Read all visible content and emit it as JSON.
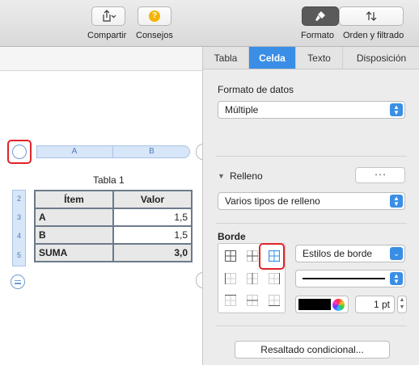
{
  "toolbar": {
    "share_label": "Compartir",
    "tips_label": "Consejos",
    "format_label": "Formato",
    "sort_label": "Orden y filtrado"
  },
  "tabs": [
    {
      "label": "Tabla"
    },
    {
      "label": "Celda"
    },
    {
      "label": "Texto"
    },
    {
      "label": "Disposición"
    }
  ],
  "data_format": {
    "title": "Formato de datos",
    "value": "Múltiple"
  },
  "fill": {
    "title": "Relleno",
    "value": "Varios tipos de relleno",
    "more_button": "• • •"
  },
  "border": {
    "title": "Borde",
    "style_label": "Estilos de borde",
    "width_value": "1 pt"
  },
  "conditional_button": "Resaltado condicional...",
  "table": {
    "title": "Tabla 1",
    "col_letters": [
      "A",
      "B"
    ],
    "header": [
      "Ítem",
      "Valor"
    ],
    "rows": [
      {
        "num": "2",
        "item": "",
        "value": ""
      },
      {
        "num": "3",
        "item": "A",
        "value": "1,5"
      },
      {
        "num": "4",
        "item": "B",
        "value": "1,5"
      },
      {
        "num": "5",
        "item": "SUMA",
        "value": "3,0"
      }
    ]
  },
  "colors": {
    "accent": "#3a8ee6",
    "highlight": "#e0232b"
  }
}
